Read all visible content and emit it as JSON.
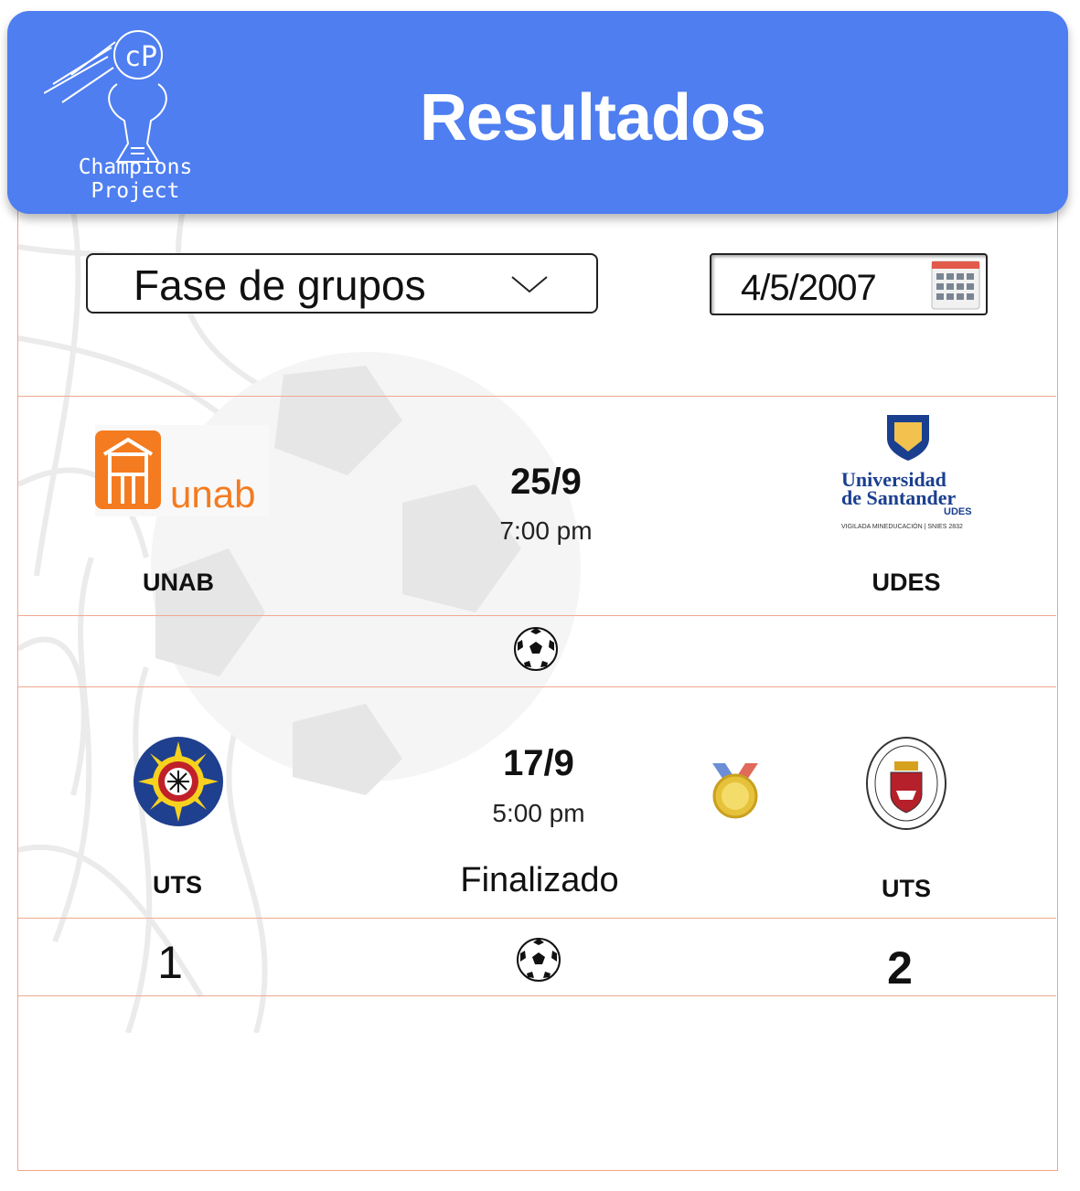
{
  "header": {
    "title": "Resultados",
    "logo_text_line1": "Champions",
    "logo_text_line2": "Project"
  },
  "filters": {
    "phase_select": "Fase de grupos",
    "date_value": "4/5/2007"
  },
  "matches": [
    {
      "home": {
        "name": "UNAB",
        "logo_text": "unab"
      },
      "away": {
        "name": "UDES",
        "logo_line1": "Universidad",
        "logo_line2": "de Santander",
        "logo_abbr": "UDES",
        "logo_caption": "VIGILADA MINEDUCACIÓN | SNIES 2832"
      },
      "date": "25/9",
      "time": "7:00 pm"
    },
    {
      "home": {
        "name": "UTS",
        "score": "1"
      },
      "away": {
        "name": "UTS",
        "score": "2"
      },
      "date": "17/9",
      "time": "5:00 pm",
      "status": "Finalizado"
    }
  ],
  "colors": {
    "header": "#4e7ef0",
    "divider": "#f0a990",
    "unab_orange": "#f47b20",
    "udes_blue": "#1a3f8f"
  },
  "icons": [
    "soccer-ball-icon",
    "calendar-icon",
    "chevron-down-icon",
    "medal-icon"
  ]
}
